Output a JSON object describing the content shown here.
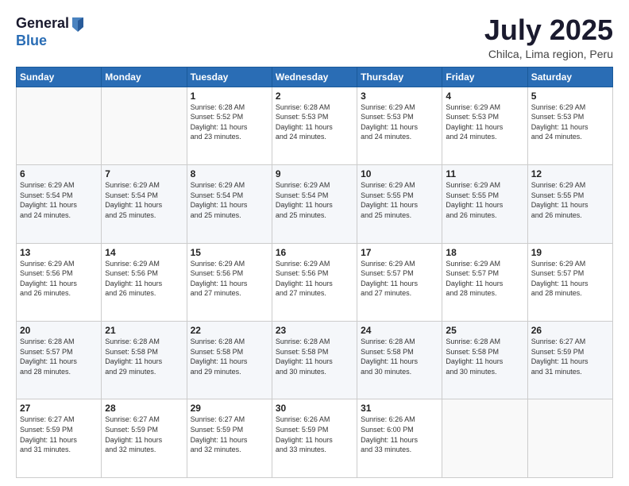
{
  "logo": {
    "general": "General",
    "blue": "Blue"
  },
  "header": {
    "month": "July 2025",
    "location": "Chilca, Lima region, Peru"
  },
  "days_of_week": [
    "Sunday",
    "Monday",
    "Tuesday",
    "Wednesday",
    "Thursday",
    "Friday",
    "Saturday"
  ],
  "weeks": [
    [
      {
        "day": "",
        "info": ""
      },
      {
        "day": "",
        "info": ""
      },
      {
        "day": "1",
        "info": "Sunrise: 6:28 AM\nSunset: 5:52 PM\nDaylight: 11 hours\nand 23 minutes."
      },
      {
        "day": "2",
        "info": "Sunrise: 6:28 AM\nSunset: 5:53 PM\nDaylight: 11 hours\nand 24 minutes."
      },
      {
        "day": "3",
        "info": "Sunrise: 6:29 AM\nSunset: 5:53 PM\nDaylight: 11 hours\nand 24 minutes."
      },
      {
        "day": "4",
        "info": "Sunrise: 6:29 AM\nSunset: 5:53 PM\nDaylight: 11 hours\nand 24 minutes."
      },
      {
        "day": "5",
        "info": "Sunrise: 6:29 AM\nSunset: 5:53 PM\nDaylight: 11 hours\nand 24 minutes."
      }
    ],
    [
      {
        "day": "6",
        "info": "Sunrise: 6:29 AM\nSunset: 5:54 PM\nDaylight: 11 hours\nand 24 minutes."
      },
      {
        "day": "7",
        "info": "Sunrise: 6:29 AM\nSunset: 5:54 PM\nDaylight: 11 hours\nand 25 minutes."
      },
      {
        "day": "8",
        "info": "Sunrise: 6:29 AM\nSunset: 5:54 PM\nDaylight: 11 hours\nand 25 minutes."
      },
      {
        "day": "9",
        "info": "Sunrise: 6:29 AM\nSunset: 5:54 PM\nDaylight: 11 hours\nand 25 minutes."
      },
      {
        "day": "10",
        "info": "Sunrise: 6:29 AM\nSunset: 5:55 PM\nDaylight: 11 hours\nand 25 minutes."
      },
      {
        "day": "11",
        "info": "Sunrise: 6:29 AM\nSunset: 5:55 PM\nDaylight: 11 hours\nand 26 minutes."
      },
      {
        "day": "12",
        "info": "Sunrise: 6:29 AM\nSunset: 5:55 PM\nDaylight: 11 hours\nand 26 minutes."
      }
    ],
    [
      {
        "day": "13",
        "info": "Sunrise: 6:29 AM\nSunset: 5:56 PM\nDaylight: 11 hours\nand 26 minutes."
      },
      {
        "day": "14",
        "info": "Sunrise: 6:29 AM\nSunset: 5:56 PM\nDaylight: 11 hours\nand 26 minutes."
      },
      {
        "day": "15",
        "info": "Sunrise: 6:29 AM\nSunset: 5:56 PM\nDaylight: 11 hours\nand 27 minutes."
      },
      {
        "day": "16",
        "info": "Sunrise: 6:29 AM\nSunset: 5:56 PM\nDaylight: 11 hours\nand 27 minutes."
      },
      {
        "day": "17",
        "info": "Sunrise: 6:29 AM\nSunset: 5:57 PM\nDaylight: 11 hours\nand 27 minutes."
      },
      {
        "day": "18",
        "info": "Sunrise: 6:29 AM\nSunset: 5:57 PM\nDaylight: 11 hours\nand 28 minutes."
      },
      {
        "day": "19",
        "info": "Sunrise: 6:29 AM\nSunset: 5:57 PM\nDaylight: 11 hours\nand 28 minutes."
      }
    ],
    [
      {
        "day": "20",
        "info": "Sunrise: 6:28 AM\nSunset: 5:57 PM\nDaylight: 11 hours\nand 28 minutes."
      },
      {
        "day": "21",
        "info": "Sunrise: 6:28 AM\nSunset: 5:58 PM\nDaylight: 11 hours\nand 29 minutes."
      },
      {
        "day": "22",
        "info": "Sunrise: 6:28 AM\nSunset: 5:58 PM\nDaylight: 11 hours\nand 29 minutes."
      },
      {
        "day": "23",
        "info": "Sunrise: 6:28 AM\nSunset: 5:58 PM\nDaylight: 11 hours\nand 30 minutes."
      },
      {
        "day": "24",
        "info": "Sunrise: 6:28 AM\nSunset: 5:58 PM\nDaylight: 11 hours\nand 30 minutes."
      },
      {
        "day": "25",
        "info": "Sunrise: 6:28 AM\nSunset: 5:58 PM\nDaylight: 11 hours\nand 30 minutes."
      },
      {
        "day": "26",
        "info": "Sunrise: 6:27 AM\nSunset: 5:59 PM\nDaylight: 11 hours\nand 31 minutes."
      }
    ],
    [
      {
        "day": "27",
        "info": "Sunrise: 6:27 AM\nSunset: 5:59 PM\nDaylight: 11 hours\nand 31 minutes."
      },
      {
        "day": "28",
        "info": "Sunrise: 6:27 AM\nSunset: 5:59 PM\nDaylight: 11 hours\nand 32 minutes."
      },
      {
        "day": "29",
        "info": "Sunrise: 6:27 AM\nSunset: 5:59 PM\nDaylight: 11 hours\nand 32 minutes."
      },
      {
        "day": "30",
        "info": "Sunrise: 6:26 AM\nSunset: 5:59 PM\nDaylight: 11 hours\nand 33 minutes."
      },
      {
        "day": "31",
        "info": "Sunrise: 6:26 AM\nSunset: 6:00 PM\nDaylight: 11 hours\nand 33 minutes."
      },
      {
        "day": "",
        "info": ""
      },
      {
        "day": "",
        "info": ""
      }
    ]
  ]
}
